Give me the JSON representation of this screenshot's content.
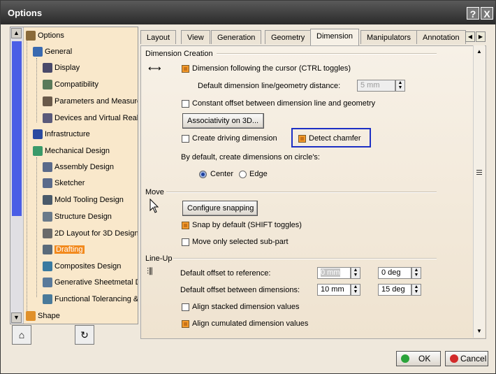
{
  "window": {
    "title": "Options",
    "help_glyph": "?",
    "close_glyph": "X"
  },
  "tree": {
    "items": [
      {
        "label": "Options",
        "icon": "options-tree-icon"
      },
      {
        "label": "General",
        "icon": "general-icon"
      },
      {
        "label": "Display",
        "icon": "display-icon"
      },
      {
        "label": "Compatibility",
        "icon": "compatibility-icon"
      },
      {
        "label": "Parameters and Measure",
        "icon": "parameters-icon"
      },
      {
        "label": "Devices and Virtual Realit",
        "icon": "devices-icon"
      },
      {
        "label": "Infrastructure",
        "icon": "infrastructure-icon"
      },
      {
        "label": "Mechanical Design",
        "icon": "mechanical-design-icon"
      },
      {
        "label": "Assembly Design",
        "icon": "assembly-icon"
      },
      {
        "label": "Sketcher",
        "icon": "sketcher-icon"
      },
      {
        "label": "Mold Tooling Design",
        "icon": "mold-tooling-icon"
      },
      {
        "label": "Structure Design",
        "icon": "structure-icon"
      },
      {
        "label": "2D Layout for 3D Design",
        "icon": "layout-2d-icon"
      },
      {
        "label": "Drafting",
        "icon": "drafting-icon"
      },
      {
        "label": "Composites Design",
        "icon": "composites-icon"
      },
      {
        "label": "Generative Sheetmetal D",
        "icon": "sheetmetal-icon"
      },
      {
        "label": "Functional Tolerancing &",
        "icon": "tolerancing-icon"
      },
      {
        "label": "Shape",
        "icon": "shape-icon"
      }
    ],
    "selected": "Drafting"
  },
  "tabs": [
    "Layout",
    "View",
    "Generation",
    "Geometry",
    "Dimension",
    "Manipulators",
    "Annotation"
  ],
  "active_tab": "Dimension",
  "dimension_creation": {
    "header": "Dimension Creation",
    "follow_cursor": "Dimension following the cursor (CTRL toggles)",
    "default_distance_label": "Default dimension line/geometry distance:",
    "default_distance_value": "5 mm",
    "constant_offset": "Constant offset between dimension line and geometry",
    "associativity_button": "Associativity on 3D...",
    "create_driving": "Create driving dimension",
    "detect_chamfer": "Detect chamfer",
    "circle_label": "By default, create dimensions on circle's:",
    "center": "Center",
    "edge": "Edge"
  },
  "move": {
    "header": "Move",
    "configure_button": "Configure snapping",
    "snap_default": "Snap by default (SHIFT toggles)",
    "move_sub_part": "Move only selected sub-part"
  },
  "lineup": {
    "header": "Line-Up",
    "offset_ref_label": "Default offset to reference:",
    "offset_ref_value": "0 mm",
    "offset_ref_angle": "0 deg",
    "offset_dims_label": "Default offset between dimensions:",
    "offset_dims_value": "10 mm",
    "offset_dims_angle": "15 deg",
    "align_stacked": "Align stacked dimension values",
    "align_cumulated": "Align cumulated dimension values"
  },
  "buttons": {
    "ok": "OK",
    "cancel": "Cancel"
  },
  "colors": {
    "accent": "#f28a1e",
    "highlight_box": "#1c2fc4",
    "scroll_thumb": "#4a5ee6"
  }
}
